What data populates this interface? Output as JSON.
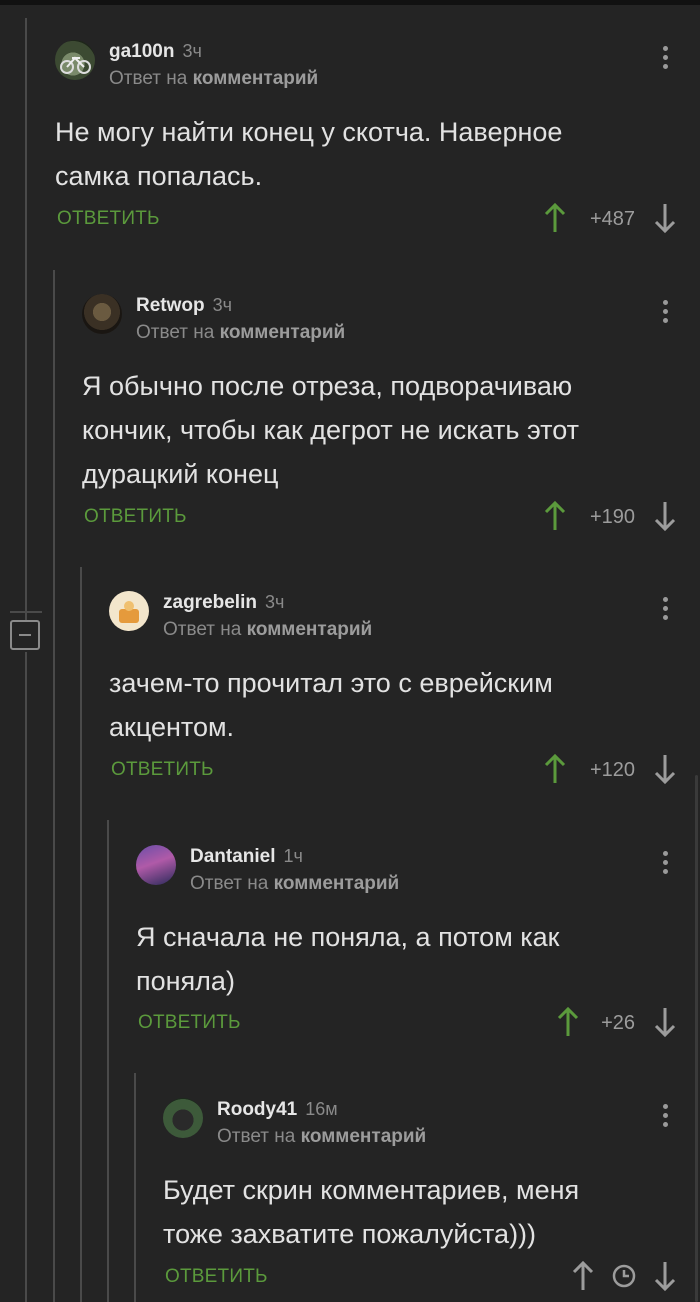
{
  "comments": [
    {
      "username": "ga100n",
      "time": "3ч",
      "reply_prefix": "Ответ на",
      "reply_target": "комментарий",
      "text": [
        "Не могу найти конец у скотча. Наверное",
        "самка попалась."
      ],
      "reply_label": "ОТВЕТИТЬ",
      "rating": "+487"
    },
    {
      "username": "Retwop",
      "time": "3ч",
      "reply_prefix": "Ответ на",
      "reply_target": "комментарий",
      "text": [
        "Я обычно после отреза, подворачиваю",
        "кончик, чтобы как дегрот не искать этот",
        "дурацкий конец"
      ],
      "reply_label": "ОТВЕТИТЬ",
      "rating": "+190"
    },
    {
      "username": "zagrebelin",
      "time": "3ч",
      "reply_prefix": "Ответ на",
      "reply_target": "комментарий",
      "text": [
        "зачем-то прочитал это с еврейским",
        "акцентом."
      ],
      "reply_label": "ОТВЕТИТЬ",
      "rating": "+120"
    },
    {
      "username": "Dantaniel",
      "time": "1ч",
      "reply_prefix": "Ответ на",
      "reply_target": "комментарий",
      "text": [
        "Я сначала не поняла, а потом как",
        "поняла)"
      ],
      "reply_label": "ОТВЕТИТЬ",
      "rating": "+26"
    },
    {
      "username": "Roody41",
      "time": "16м",
      "reply_prefix": "Ответ на",
      "reply_target": "комментарий",
      "text": [
        "Будет скрин комментариев, меня",
        "тоже захватите пожалуйста)))"
      ],
      "reply_label": "ОТВЕТИТЬ",
      "rating": ""
    }
  ],
  "colors": {
    "background": "#242424",
    "accent_green": "#5b9a3c",
    "muted": "#8a8a8a"
  }
}
